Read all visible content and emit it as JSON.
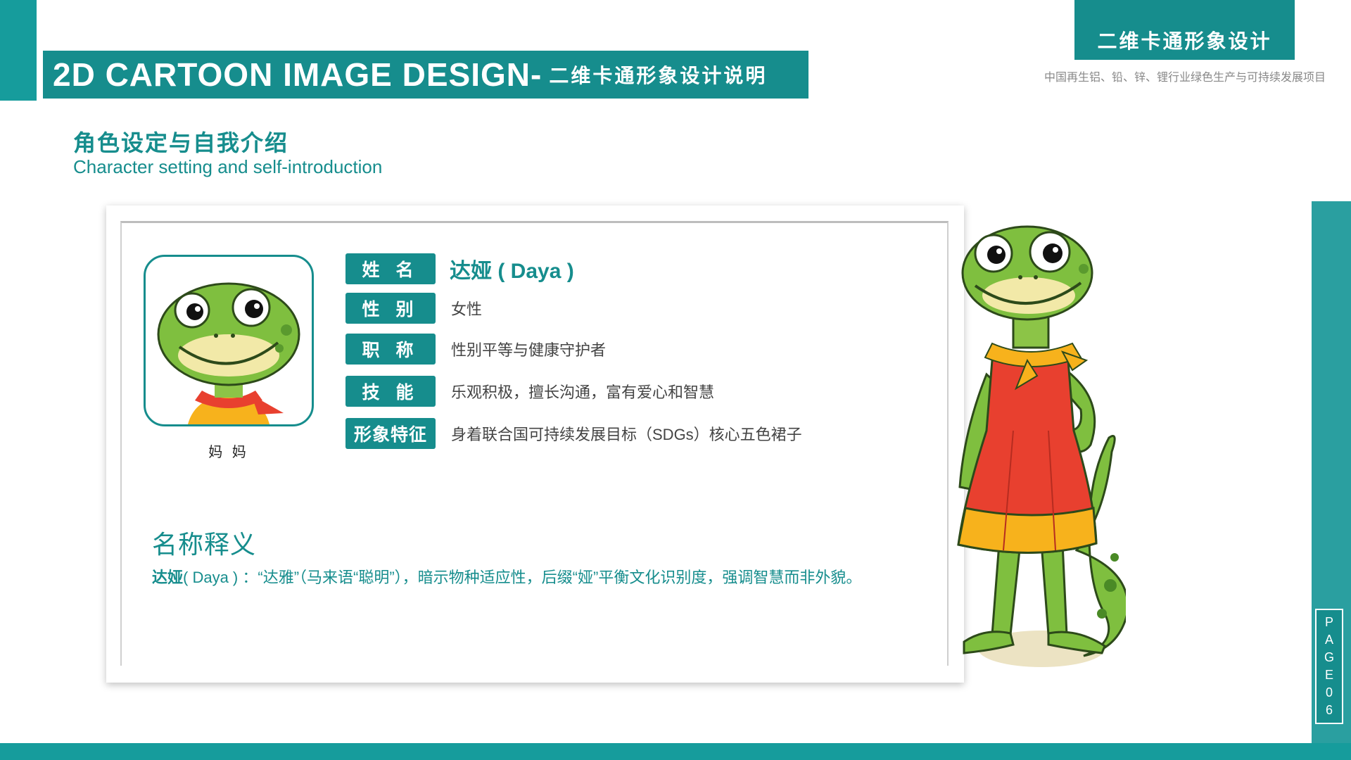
{
  "header": {
    "banner_en": "2D CARTOON IMAGE DESIGN-",
    "banner_cn": "二维卡通形象设计说明",
    "corner_title": "二维卡通形象设计",
    "project_subtitle": "中国再生铝、铅、锌、锂行业绿色生产与可持续发展项目"
  },
  "section": {
    "title_cn": "角色设定与自我介绍",
    "title_en": "Character setting and self-introduction"
  },
  "profile": {
    "avatar_caption": "妈 妈",
    "rows": [
      {
        "label": "姓 名",
        "value": "达娅 ( Daya )"
      },
      {
        "label": "性 别",
        "value": "女性"
      },
      {
        "label": "职 称",
        "value": "性别平等与健康守护者"
      },
      {
        "label": "技 能",
        "value": "乐观积极，擅长沟通，富有爱心和智慧"
      },
      {
        "label": "形象特征",
        "value": "身着联合国可持续发展目标（SDGs）核心五色裙子"
      }
    ]
  },
  "meaning": {
    "title": "名称释义",
    "name_bold": "达娅",
    "text": "( Daya ) ：“达雅”（马来语“聪明”），暗示物种适应性，后缀“娅”平衡文化识别度，强调智慧而非外貌。"
  },
  "page_tag": [
    "P",
    "A",
    "G",
    "E",
    "0",
    "6"
  ],
  "colors": {
    "accent": "#168d8d",
    "dress_red": "#e8402f",
    "dress_yellow": "#f7b21c",
    "skin_green": "#7fbf3f"
  }
}
